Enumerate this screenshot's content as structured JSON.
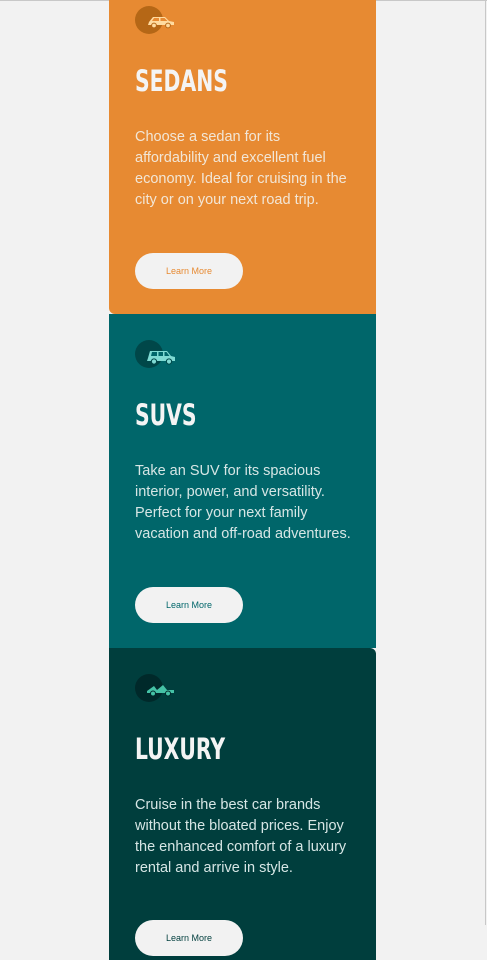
{
  "colors": {
    "sedans_bg": "#e78a32",
    "suvs_bg": "#00666a",
    "luxury_bg": "#003e3d",
    "page_bg": "#f2f2f2",
    "title_text": "#f4f4f4"
  },
  "cards": [
    {
      "icon": "sedan-car-icon",
      "title": "SEDANS",
      "description": "Choose a sedan for its affordability and excellent fuel economy. Ideal for cruising in the city or on your next road trip.",
      "button_label": "Learn More"
    },
    {
      "icon": "suv-car-icon",
      "title": "SUVS",
      "description": "Take an SUV for its spacious interior, power, and versatility. Perfect for your next family vacation and off-road adventures.",
      "button_label": "Learn More"
    },
    {
      "icon": "luxury-car-icon",
      "title": "LUXURY",
      "description": "Cruise in the best car brands without the bloated prices. Enjoy the enhanced comfort of a luxury rental and arrive in style.",
      "button_label": "Learn More"
    }
  ]
}
